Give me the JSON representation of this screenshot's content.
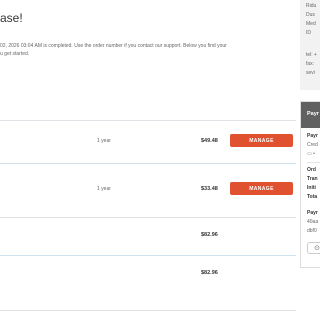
{
  "header": {
    "title": "ase!",
    "intro_lines": [
      "02, 2026 03:04 AM is completed. Use the order number if you contact our support. Below you find your",
      "u get started."
    ]
  },
  "orders": [
    {
      "duration": "1 year",
      "price": "$49.48",
      "action": "MANAGE"
    },
    {
      "duration": "1 year",
      "price": "$33.48",
      "action": "MANAGE"
    }
  ],
  "totals": {
    "subtotal": "$82.96",
    "total": "$82.96"
  },
  "sidebar": {
    "address_lines": [
      "Ridu",
      "Dus",
      "Med",
      "ID"
    ],
    "contact_lines": [
      "tel: +",
      "fax:",
      "sevi"
    ],
    "payment": {
      "title": "Payr",
      "method_label": "Payr",
      "method_value": "Cred",
      "card_icon_text": "▭ •",
      "order_label": "Ord",
      "transaction_label": "Tran",
      "initiated_label": "Initi",
      "total_label": "Tota",
      "ref_label": "Payr",
      "ref_value_1": "40aa",
      "ref_value_2": "dbf0",
      "button_icon": "⊙"
    }
  },
  "colors": {
    "manage_button": "#e0522f",
    "payment_header": "#616161"
  }
}
